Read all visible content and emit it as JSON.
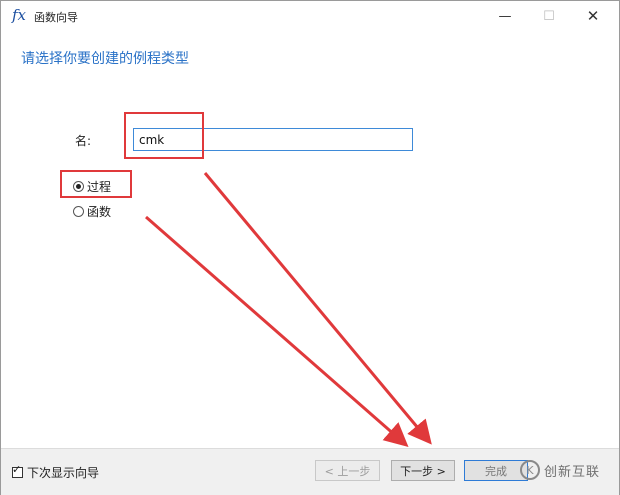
{
  "window": {
    "icon_text": "fx",
    "title": "函数向导",
    "controls": {
      "minimize": "—",
      "maximize": "☐",
      "close": "✕"
    }
  },
  "heading": "请选择你要创建的例程类型",
  "form": {
    "name_label": "名:",
    "name_value": "cmk",
    "options": [
      {
        "label": "过程",
        "selected": true
      },
      {
        "label": "函数",
        "selected": false
      }
    ]
  },
  "footer": {
    "show_wizard_label": "下次显示向导",
    "show_wizard_checked": true,
    "check_mark": "✓",
    "prev_label": "< 上一步",
    "next_label": "下一步 >",
    "finish_label": "完成"
  },
  "watermark": {
    "logo": "K",
    "text": "创新互联"
  },
  "colors": {
    "accent": "#2a72c7",
    "highlight": "#e0393b"
  }
}
